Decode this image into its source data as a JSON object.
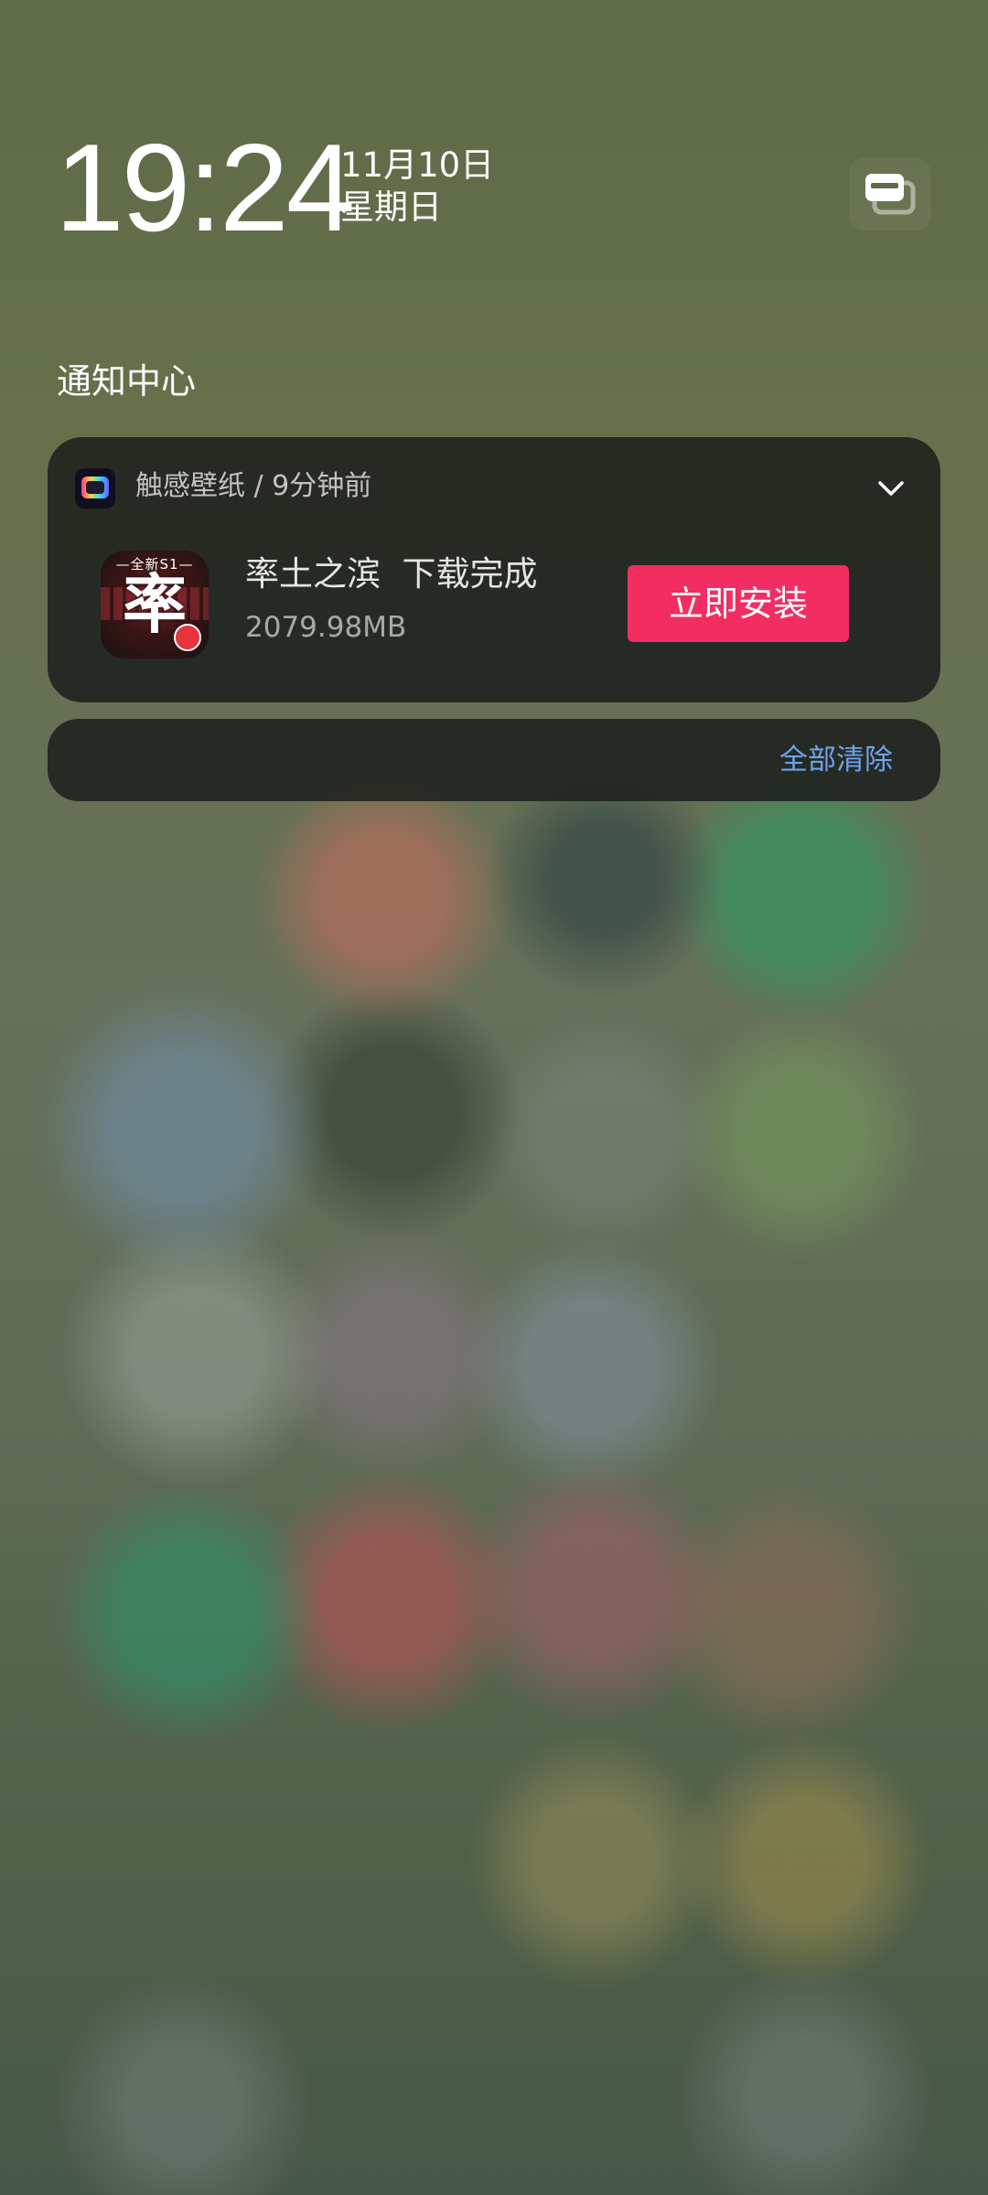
{
  "lockscreen": {
    "time": "19:24",
    "date": "11月10日",
    "weekday": "星期日"
  },
  "notification_center": {
    "title": "通知中心",
    "clear_all_label": "全部清除"
  },
  "notification": {
    "app_name": "触感壁纸",
    "separator": " / ",
    "time_ago": "9分钟前",
    "header": "触感壁纸 / 9分钟前",
    "title": "率土之滨  下载完成",
    "size": "2079.98MB",
    "action_label": "立即安装",
    "game_icon": {
      "top_text": "—全新S1—",
      "main_char": "率"
    },
    "colors": {
      "action_button": "#f22d62",
      "clear_link": "#6fa3ee"
    }
  },
  "icons": {
    "top_right": "notification-style-toggle-icon",
    "expand": "chevron-down-icon"
  }
}
